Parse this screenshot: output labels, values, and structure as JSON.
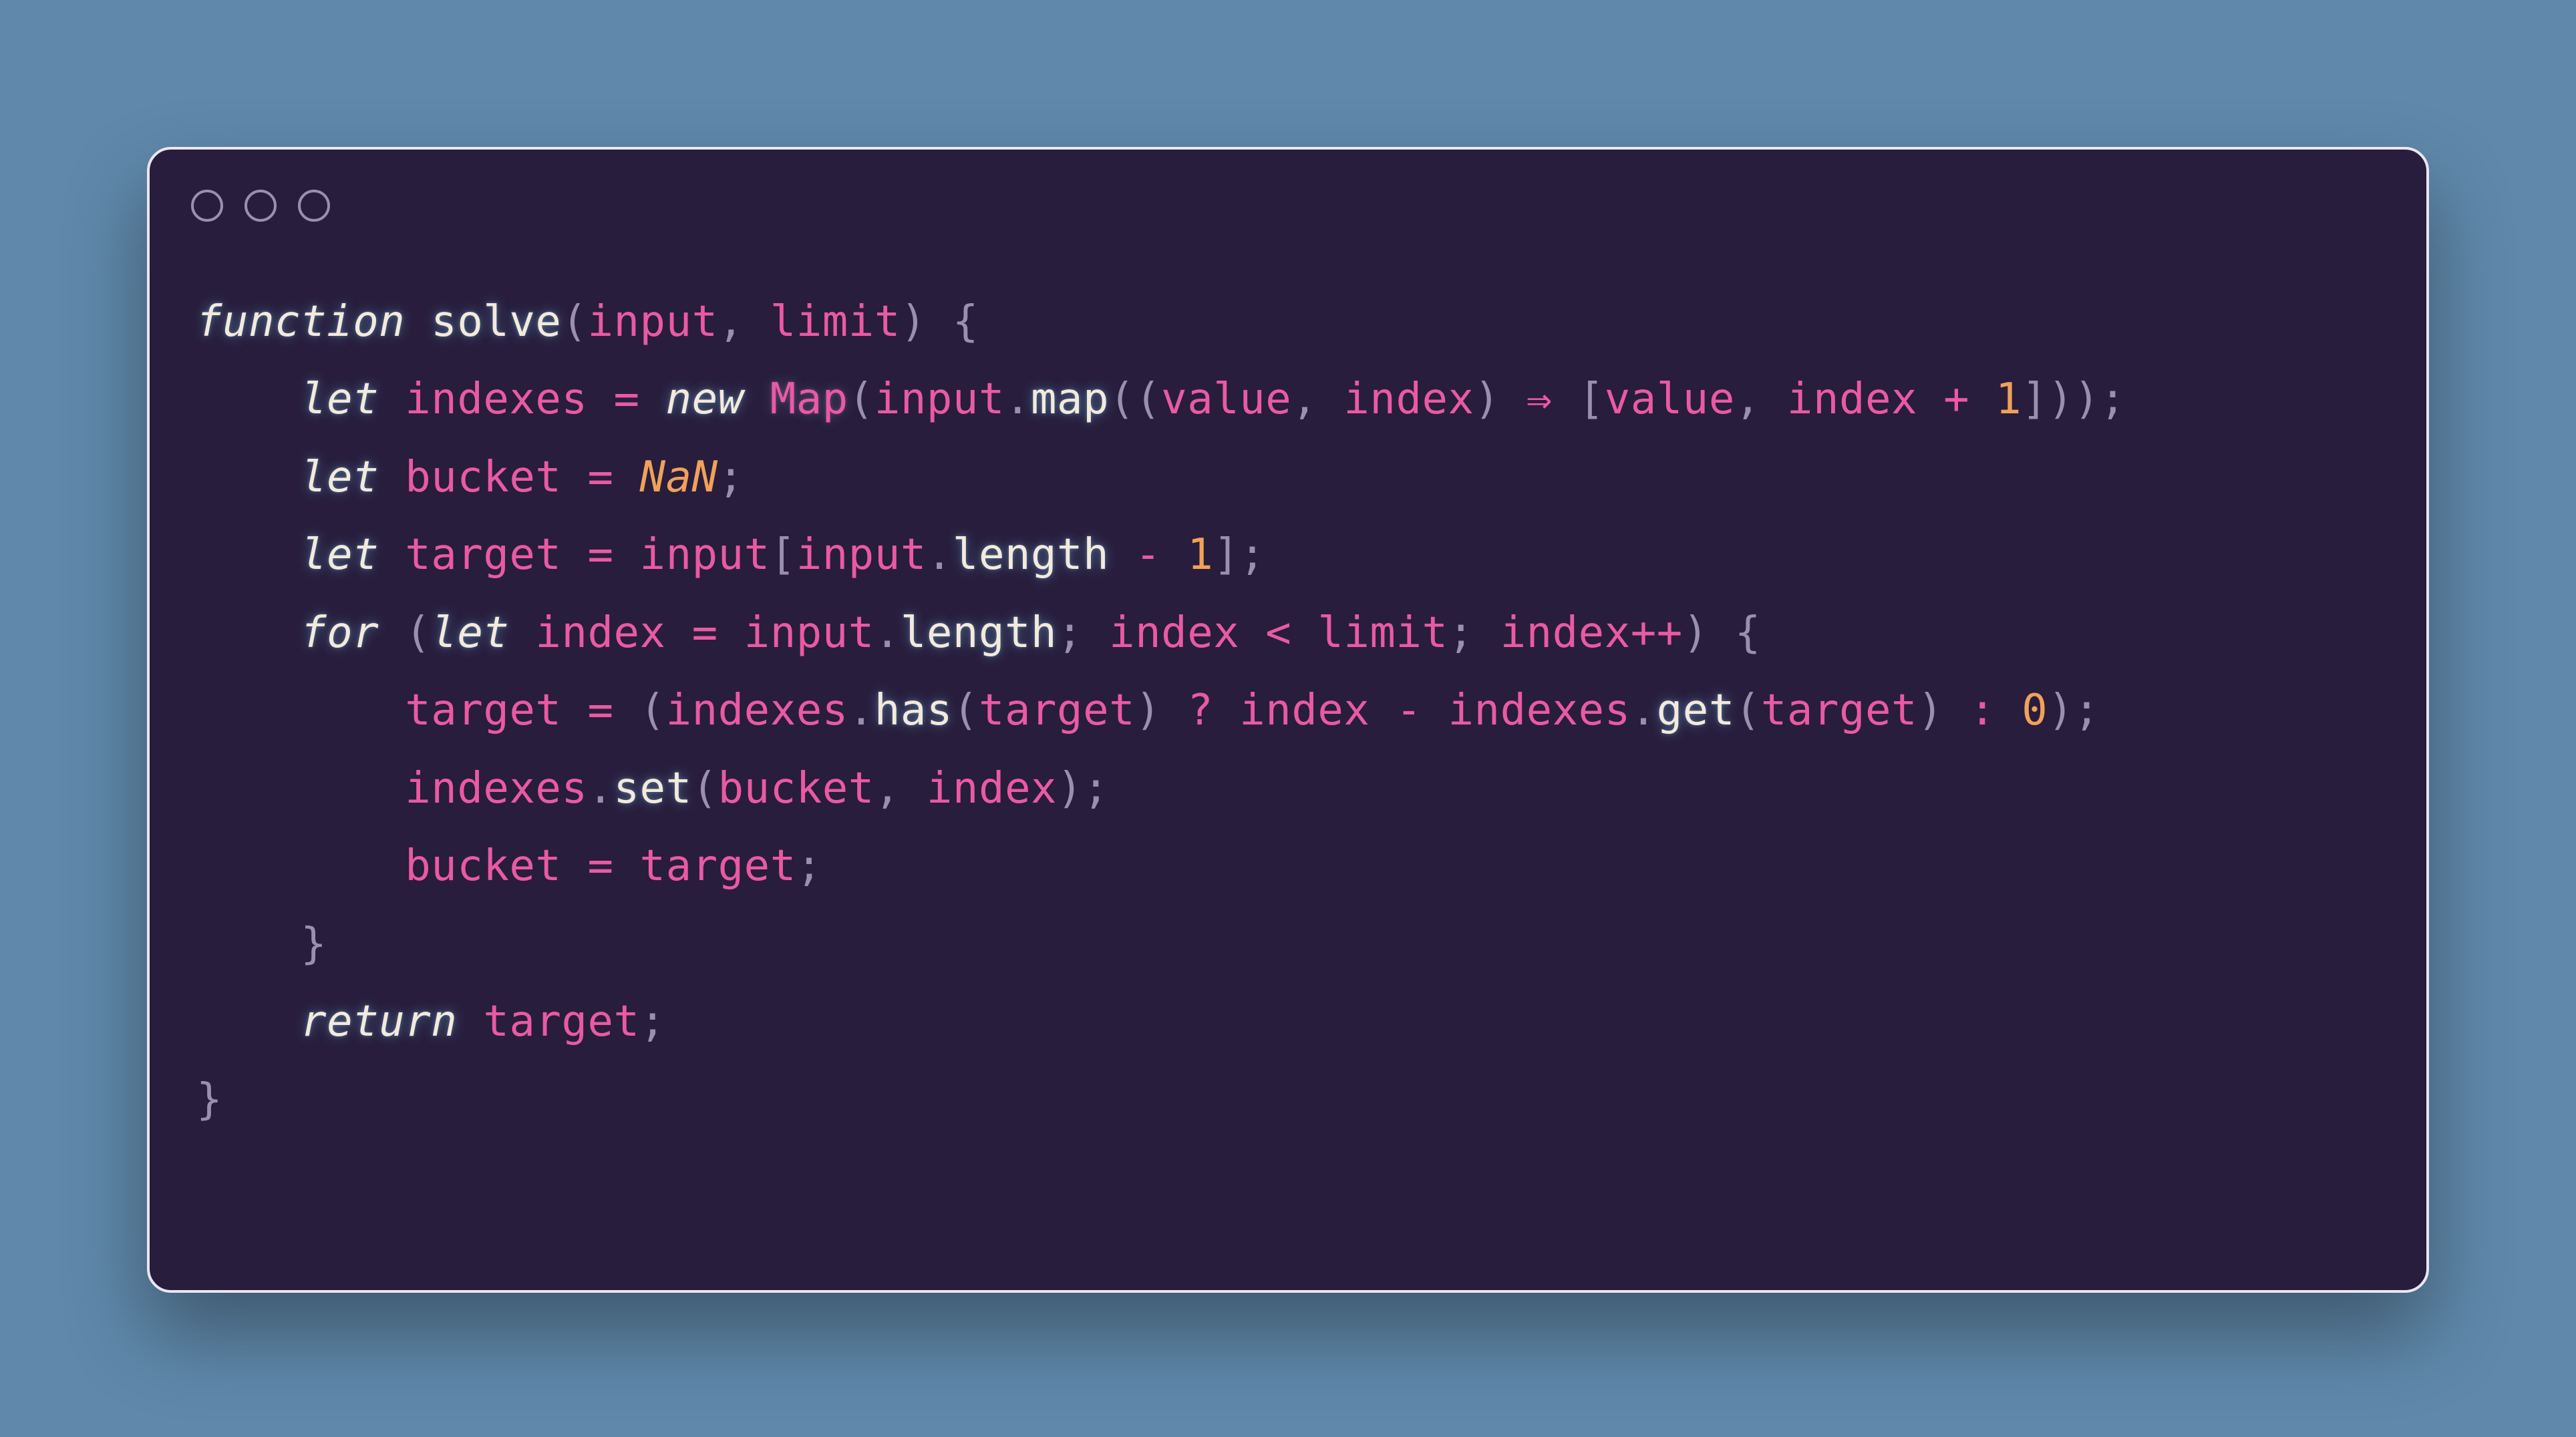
{
  "colors": {
    "page_bg": "#5f88aa",
    "card_bg": "#281d3c",
    "card_border": "#eae6f2",
    "traffic_light_ring": "#9a8fae",
    "text_default": "#eae6e0",
    "keyword": "#f4eadb",
    "function_decl": "#f4eadb",
    "class_name": "#e95aa3",
    "identifier": "#e95aa3",
    "method_call": "#f4eadb",
    "punctuation": "#9a8fae",
    "operator": "#e95aa3",
    "number": "#f0a15a",
    "constant": "#f0a15a"
  },
  "tok": {
    "kw_function": "function",
    "fn_solve": "solve",
    "id_input": "input",
    "id_limit": "limit",
    "kw_let": "let",
    "id_indexes": "indexes",
    "kw_new": "new",
    "cls_Map": "Map",
    "call_map": "map",
    "id_value": "value",
    "id_index": "index",
    "num_1": "1",
    "id_bucket": "bucket",
    "con_NaN": "NaN",
    "id_target": "target",
    "call_length": "length",
    "kw_for": "for",
    "call_has": "has",
    "call_get": "get",
    "num_0": "0",
    "call_set": "set",
    "kw_return": "return",
    "p_lparen": "(",
    "p_rparen": ")",
    "p_lbrace": "{",
    "p_rbrace": "}",
    "p_lbracket": "[",
    "p_rbracket": "]",
    "p_comma": ",",
    "p_semi": ";",
    "p_dot": ".",
    "p_q": "?",
    "p_colon": ":",
    "op_eq": "=",
    "op_arrow": "⇒",
    "op_plus": "+",
    "op_minus": "-",
    "op_lt": "<",
    "op_inc": "++"
  }
}
